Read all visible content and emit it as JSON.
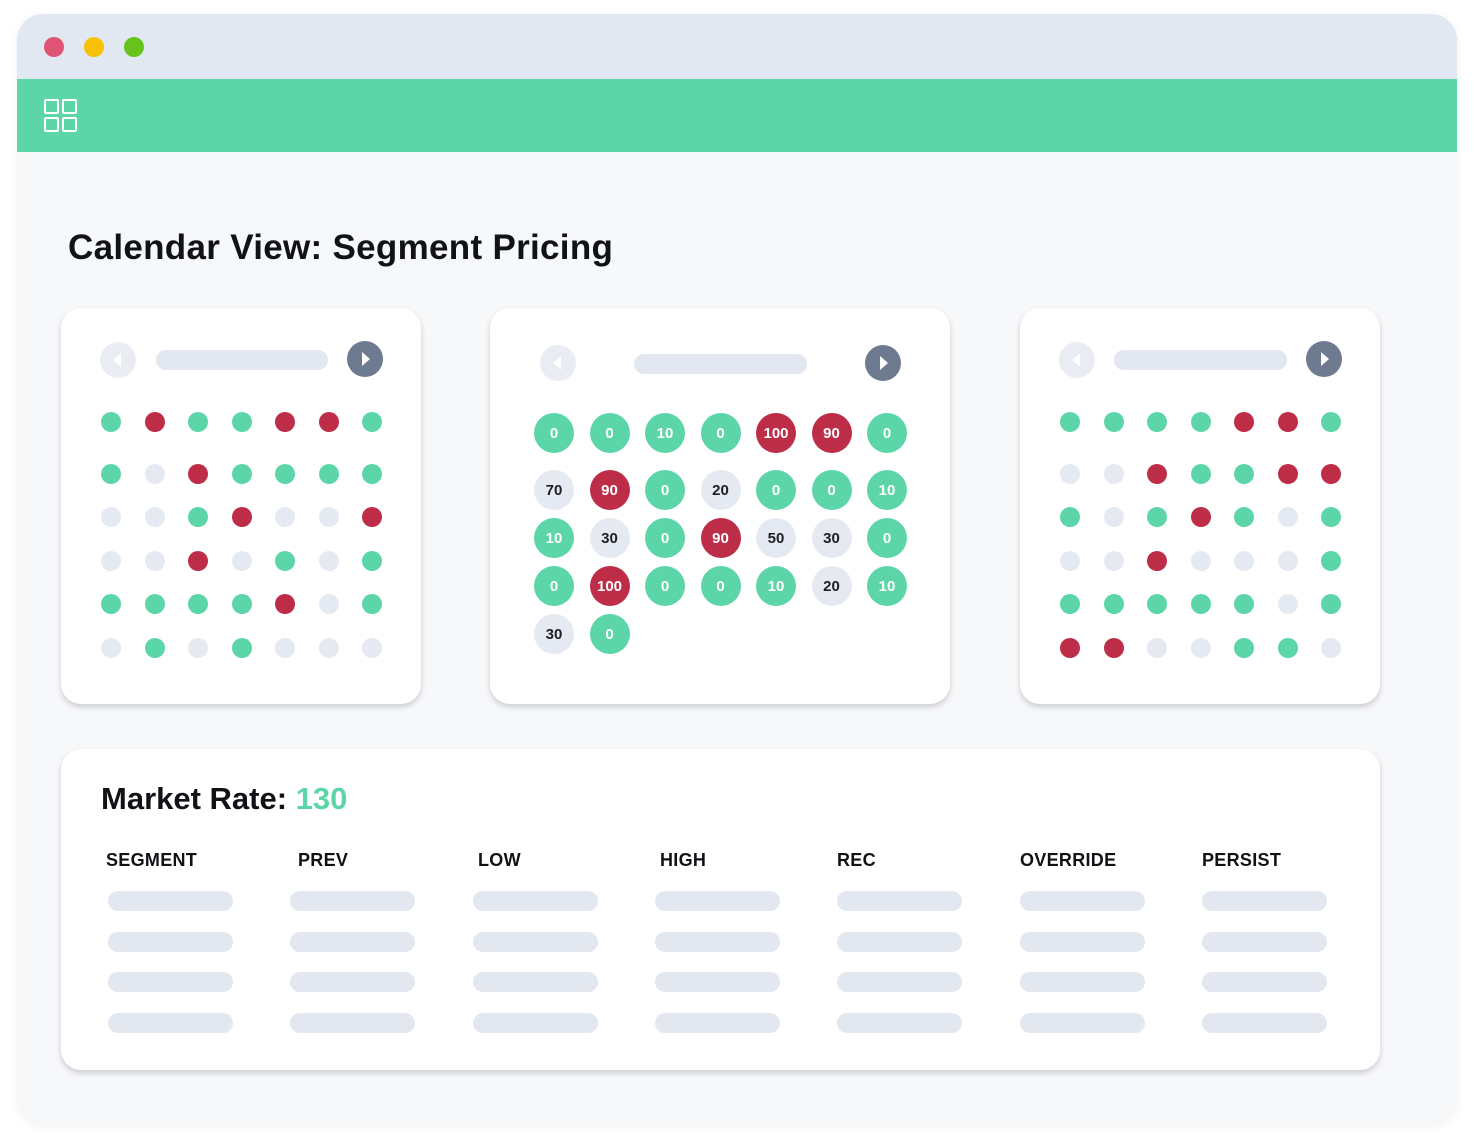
{
  "window": {
    "controls": [
      "close",
      "minimize",
      "maximize"
    ],
    "controlColors": {
      "close": "#df5474",
      "minimize": "#f7c204",
      "maximize": "#67c31c"
    }
  },
  "appbar": {
    "icon": "grid-icon",
    "color": "#5cd6a9"
  },
  "page": {
    "title": "Calendar View: Segment Pricing"
  },
  "colors": {
    "green": "#5cd6a9",
    "red": "#bd2d48",
    "grey": "#e5eaf2"
  },
  "calendars": {
    "left": {
      "rows": [
        [
          "green",
          "red",
          "green",
          "green",
          "red",
          "red",
          "green"
        ],
        [
          "green",
          "grey",
          "red",
          "green",
          "green",
          "green",
          "green"
        ],
        [
          "grey",
          "grey",
          "green",
          "red",
          "grey",
          "grey",
          "red"
        ],
        [
          "grey",
          "grey",
          "red",
          "grey",
          "green",
          "grey",
          "green"
        ],
        [
          "green",
          "green",
          "green",
          "green",
          "red",
          "grey",
          "green"
        ],
        [
          "grey",
          "green",
          "grey",
          "green",
          "grey",
          "grey",
          "grey"
        ]
      ]
    },
    "middle": {
      "rows": [
        [
          {
            "v": "0",
            "c": "green"
          },
          {
            "v": "0",
            "c": "green"
          },
          {
            "v": "10",
            "c": "green"
          },
          {
            "v": "0",
            "c": "green"
          },
          {
            "v": "100",
            "c": "red"
          },
          {
            "v": "90",
            "c": "red"
          },
          {
            "v": "0",
            "c": "green"
          }
        ],
        [
          {
            "v": "70",
            "c": "grey"
          },
          {
            "v": "90",
            "c": "red"
          },
          {
            "v": "0",
            "c": "green"
          },
          {
            "v": "20",
            "c": "grey"
          },
          {
            "v": "0",
            "c": "green"
          },
          {
            "v": "0",
            "c": "green"
          },
          {
            "v": "10",
            "c": "green"
          }
        ],
        [
          {
            "v": "10",
            "c": "green"
          },
          {
            "v": "30",
            "c": "grey"
          },
          {
            "v": "0",
            "c": "green"
          },
          {
            "v": "90",
            "c": "red"
          },
          {
            "v": "50",
            "c": "grey"
          },
          {
            "v": "30",
            "c": "grey"
          },
          {
            "v": "0",
            "c": "green"
          }
        ],
        [
          {
            "v": "0",
            "c": "green"
          },
          {
            "v": "100",
            "c": "red"
          },
          {
            "v": "0",
            "c": "green"
          },
          {
            "v": "0",
            "c": "green"
          },
          {
            "v": "10",
            "c": "green"
          },
          {
            "v": "20",
            "c": "grey"
          },
          {
            "v": "10",
            "c": "green"
          }
        ],
        [
          {
            "v": "30",
            "c": "grey"
          },
          {
            "v": "0",
            "c": "green"
          }
        ]
      ]
    },
    "right": {
      "rows": [
        [
          "green",
          "green",
          "green",
          "green",
          "red",
          "red",
          "green"
        ],
        [
          "grey",
          "grey",
          "red",
          "green",
          "green",
          "red",
          "red"
        ],
        [
          "green",
          "grey",
          "green",
          "red",
          "green",
          "grey",
          "green"
        ],
        [
          "grey",
          "grey",
          "red",
          "grey",
          "grey",
          "grey",
          "green"
        ],
        [
          "green",
          "green",
          "green",
          "green",
          "green",
          "grey",
          "green"
        ],
        [
          "red",
          "red",
          "grey",
          "grey",
          "green",
          "green",
          "grey"
        ]
      ]
    }
  },
  "market": {
    "label": "Market Rate:",
    "rate": "130",
    "columns": [
      "SEGMENT",
      "PREV",
      "LOW",
      "HIGH",
      "REC",
      "OVERRIDE",
      "PERSIST"
    ],
    "placeholderRows": 4
  }
}
